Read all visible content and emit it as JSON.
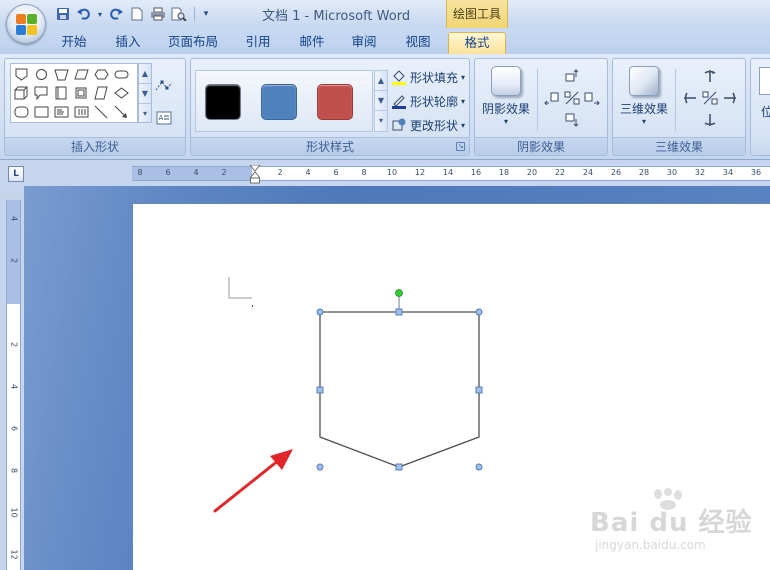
{
  "window": {
    "title": "文档 1 - Microsoft Word",
    "context_tab_label": "绘图工具"
  },
  "quick_access": {
    "icons": [
      "save-icon",
      "undo-icon",
      "redo-icon",
      "new-document-icon",
      "print-icon",
      "print-preview-icon",
      "customize-toolbar-icon"
    ]
  },
  "tabs": [
    {
      "label": "开始"
    },
    {
      "label": "插入"
    },
    {
      "label": "页面布局"
    },
    {
      "label": "引用"
    },
    {
      "label": "邮件"
    },
    {
      "label": "审阅"
    },
    {
      "label": "视图"
    },
    {
      "label": "格式",
      "active": true
    }
  ],
  "ribbon": {
    "insert_shapes": {
      "label": "插入形状",
      "shapes": [
        "pentagon-shape",
        "oval-shape",
        "trapezoid-shape",
        "parallelogram-shape",
        "hexagon-shape",
        "rounded-rect-shape",
        "cube-shape",
        "callout-shape",
        "rectangle-shape",
        "bracket-shape",
        "diagonal-shape",
        "diamond-shape",
        "rounded-rect-shape",
        "rectangle-shape",
        "text-box-shape",
        "vertical-text-box-shape",
        "line-shape",
        "arrow-shape"
      ]
    },
    "shape_styles": {
      "label": "形状样式",
      "swatches": [
        {
          "name": "black-style",
          "color": "#000000"
        },
        {
          "name": "blue-style",
          "color": "#4f81bd"
        },
        {
          "name": "red-style",
          "color": "#c0504d"
        }
      ],
      "fill_label": "形状填充",
      "outline_label": "形状轮廓",
      "change_label": "更改形状"
    },
    "shadow": {
      "label": "阴影效果",
      "button_label": "阴影效果"
    },
    "threed": {
      "label": "三维效果",
      "button_label": "三维效果"
    },
    "position": {
      "button_label": "位"
    }
  },
  "ruler": {
    "corner_label": "L",
    "h_numbers": [
      "8",
      "6",
      "4",
      "2",
      "2",
      "4",
      "6",
      "8",
      "10",
      "12",
      "14",
      "16",
      "18",
      "20",
      "22",
      "24",
      "26",
      "28",
      "30",
      "32",
      "34",
      "36"
    ],
    "v_numbers": [
      "4",
      "2",
      "2",
      "4",
      "6",
      "8",
      "10",
      "12"
    ]
  },
  "colors": {
    "accent": "#4f81bd",
    "shape_outline": "#505050",
    "handle": "#6f9bd6",
    "rotate_handle": "#33cc33",
    "arrow": "#e0262a"
  },
  "watermark": {
    "main": "Bai du 经验",
    "sub": "jingyan.baidu.com"
  }
}
